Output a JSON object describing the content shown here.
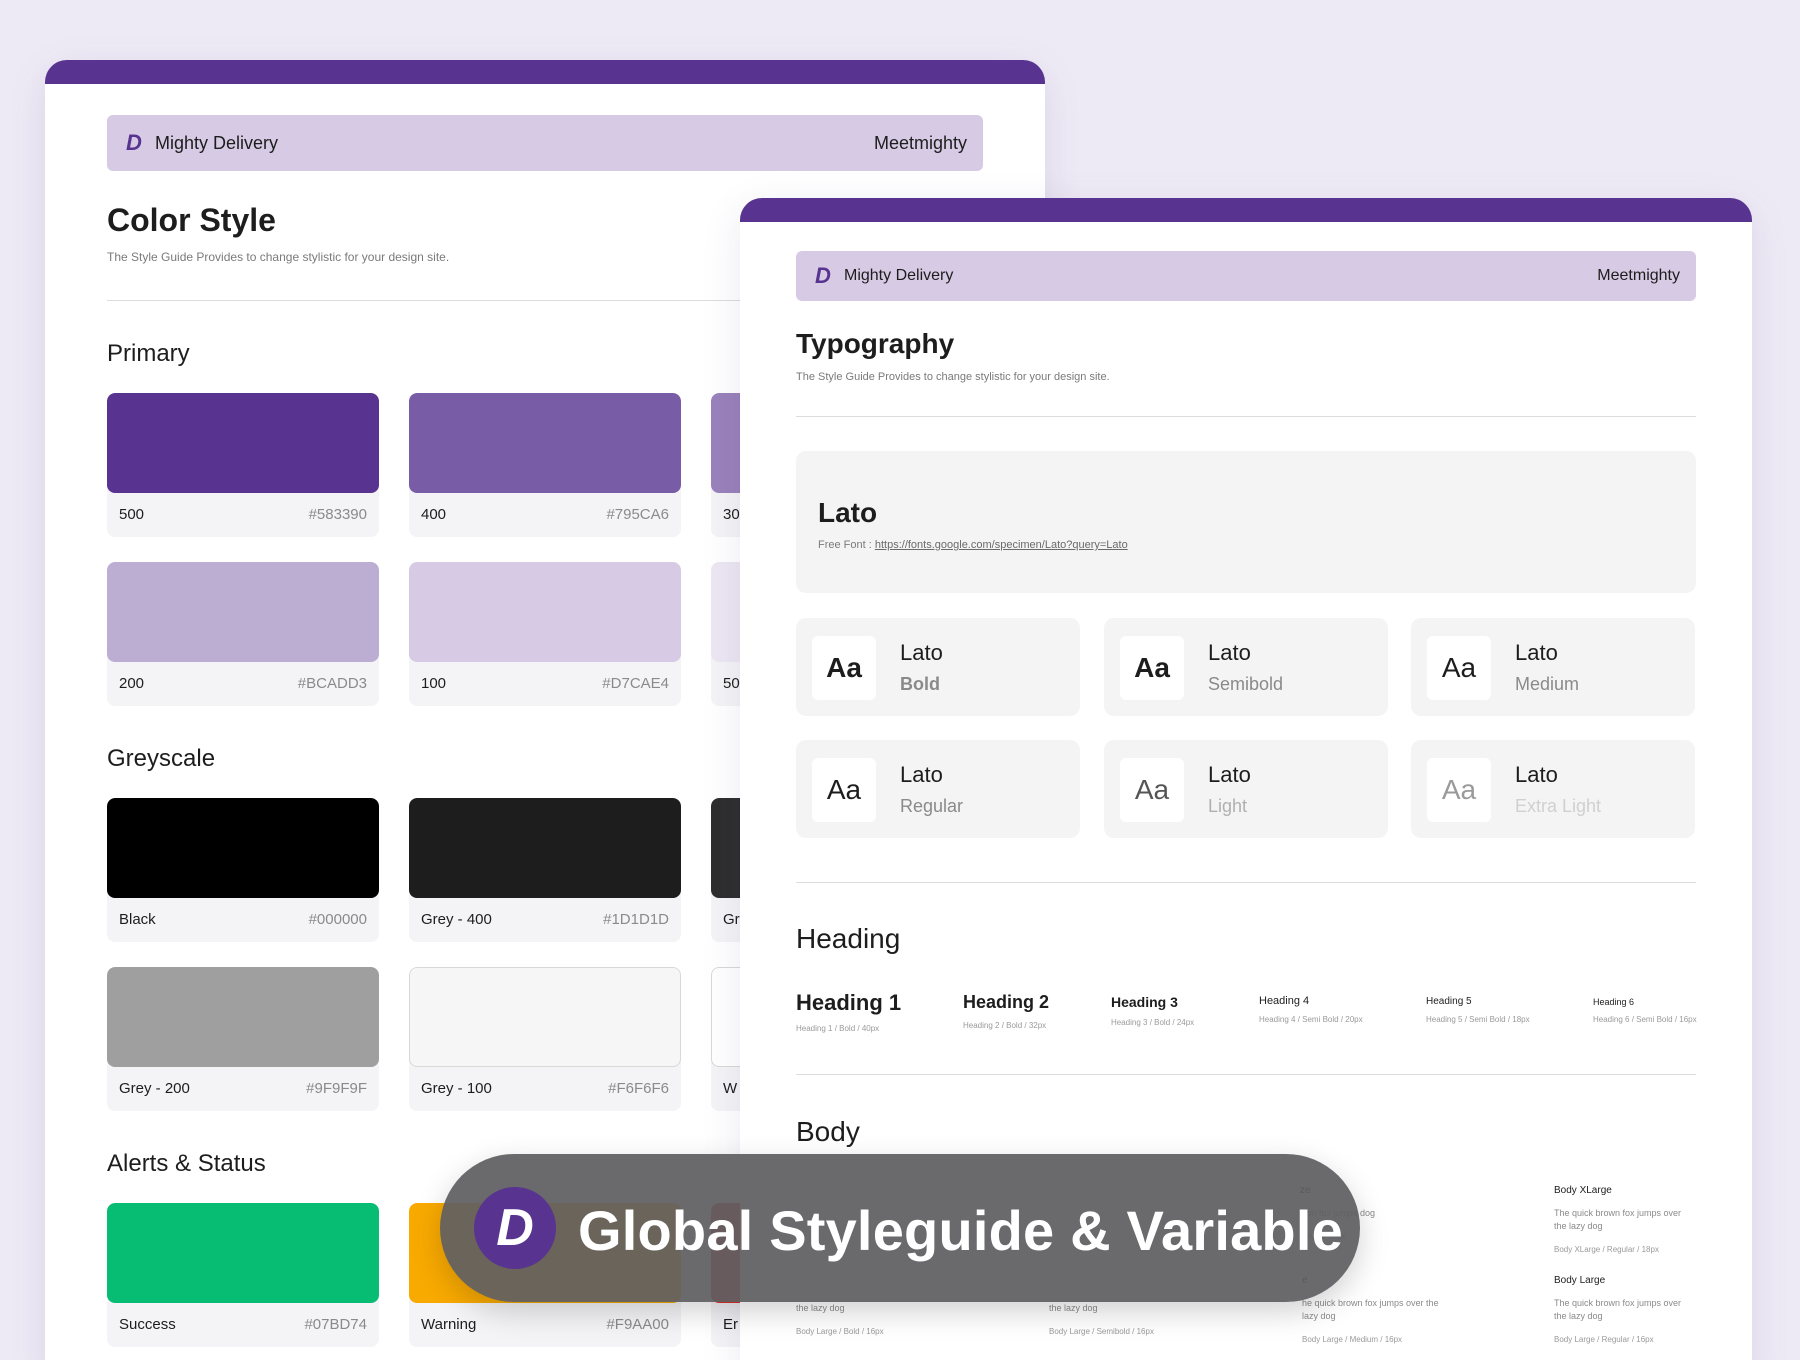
{
  "brand": {
    "name": "Mighty Delivery",
    "right": "Meetmighty",
    "logo_letter": "D",
    "accent": "#583390"
  },
  "color_page": {
    "title": "Color Style",
    "subtitle": "The Style Guide Provides to change stylistic for your design site.",
    "primary_title": "Primary",
    "primary": [
      {
        "name": "500",
        "hex": "#583390"
      },
      {
        "name": "400",
        "hex": "#795CA6"
      },
      {
        "name": "30"
      },
      {
        "name": "200",
        "hex": "#BCADD3"
      },
      {
        "name": "100",
        "hex": "#D7CAE4"
      },
      {
        "name": "50"
      }
    ],
    "greyscale_title": "Greyscale",
    "greyscale": [
      {
        "name": "Black",
        "hex": "#000000"
      },
      {
        "name": "Grey - 400",
        "hex": "#1D1D1D"
      },
      {
        "name": "Gr"
      },
      {
        "name": "Grey - 200",
        "hex": "#9F9F9F"
      },
      {
        "name": "Grey - 100",
        "hex": "#F6F6F6"
      },
      {
        "name": "W"
      }
    ],
    "alerts_title": "Alerts & Status",
    "alerts": [
      {
        "name": "Success",
        "hex": "#07BD74"
      },
      {
        "name": "Warning",
        "hex": "#F9AA00"
      },
      {
        "name": "Er"
      }
    ]
  },
  "type_page": {
    "title": "Typography",
    "subtitle": "The Style Guide Provides to change stylistic for your design site.",
    "font_name": "Lato",
    "free_font_label": "Free Font :",
    "free_font_url": "https://fonts.google.com/specimen/Lato?query=Lato",
    "aa": "Aa",
    "weights": [
      {
        "family": "Lato",
        "label": "Bold"
      },
      {
        "family": "Lato",
        "label": "Semibold"
      },
      {
        "family": "Lato",
        "label": "Medium"
      },
      {
        "family": "Lato",
        "label": "Regular"
      },
      {
        "family": "Lato",
        "label": "Light"
      },
      {
        "family": "Lato",
        "label": "Extra Light"
      }
    ],
    "heading_title": "Heading",
    "headings": [
      {
        "label": "Heading 1",
        "spec": "Heading 1 / Bold / 40px"
      },
      {
        "label": "Heading 2",
        "spec": "Heading 2 / Bold / 32px"
      },
      {
        "label": "Heading 3",
        "spec": "Heading 3 / Bold / 24px"
      },
      {
        "label": "Heading 4",
        "spec": "Heading 4 / Semi Bold / 20px"
      },
      {
        "label": "Heading 5",
        "spec": "Heading 5 / Semi Bold / 18px"
      },
      {
        "label": "Heading 6",
        "spec": "Heading 6 / Semi Bold / 16px"
      }
    ],
    "body_title": "Body",
    "body_xlarge": {
      "title": "Body XLarge",
      "text": "The quick brown fox jumps over the lazy dog",
      "spec": "Body XLarge / Regular / 18px"
    },
    "body_xlarge_partial": {
      "title": "ze",
      "text": "own fox jumps\ndog",
      "spec": "edium / 18px"
    },
    "body_large": {
      "title": "Body Large",
      "text": "The quick brown fox jumps over the lazy dog",
      "spec": "Body Large / Regular / 16px"
    },
    "body_large_medium": {
      "title": "e",
      "text": "he quick brown fox jumps over the lazy dog",
      "spec": "Body Large / Medium / 16px"
    },
    "body_large_semibold": {
      "text": "the lazy dog",
      "spec": "Body Large / Semibold / 16px"
    },
    "body_large_bold": {
      "text": "the lazy dog",
      "spec": "Body Large / Bold / 16px"
    }
  },
  "banner": {
    "text": "Global Styleguide & Variable",
    "logo_letter": "D"
  }
}
